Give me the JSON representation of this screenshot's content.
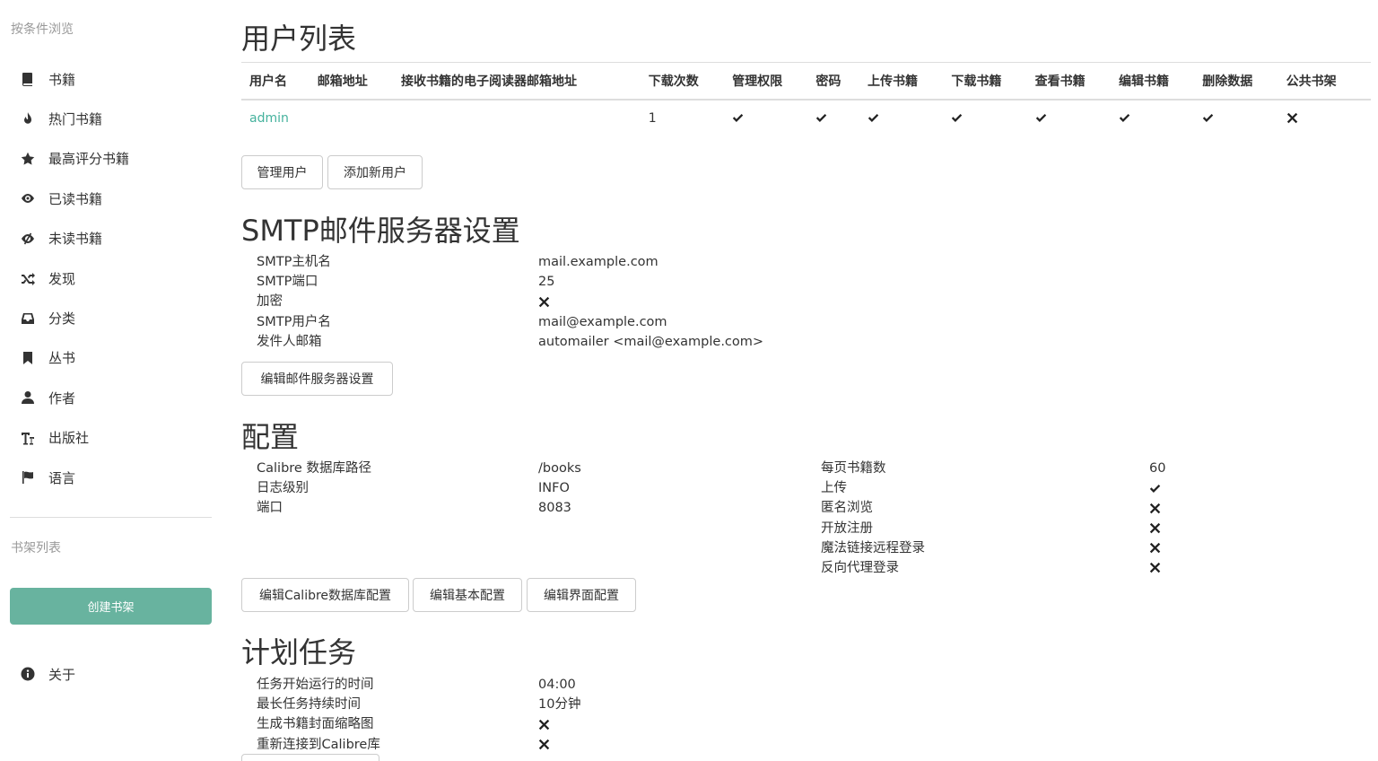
{
  "sidebar": {
    "browse_heading": "按条件浏览",
    "items": [
      {
        "label": "书籍",
        "icon": "book-icon"
      },
      {
        "label": "热门书籍",
        "icon": "fire-icon"
      },
      {
        "label": "最高评分书籍",
        "icon": "star-icon"
      },
      {
        "label": "已读书籍",
        "icon": "eye-icon"
      },
      {
        "label": "未读书籍",
        "icon": "eye-slash-icon"
      },
      {
        "label": "发现",
        "icon": "random-icon"
      },
      {
        "label": "分类",
        "icon": "inbox-icon"
      },
      {
        "label": "丛书",
        "icon": "bookmark-icon"
      },
      {
        "label": "作者",
        "icon": "user-icon"
      },
      {
        "label": "出版社",
        "icon": "text-size-icon"
      },
      {
        "label": "语言",
        "icon": "flag-icon"
      }
    ],
    "shelves_heading": "书架列表",
    "create_shelf": "创建书架",
    "about": "关于"
  },
  "users": {
    "title": "用户列表",
    "columns": [
      "用户名",
      "邮箱地址",
      "接收书籍的电子阅读器邮箱地址",
      "下载次数",
      "管理权限",
      "密码",
      "上传书籍",
      "下载书籍",
      "查看书籍",
      "编辑书籍",
      "删除数据",
      "公共书架"
    ],
    "rows": [
      {
        "username": "admin",
        "email": "",
        "kindle": "",
        "downloads": "1",
        "admin": true,
        "password": true,
        "upload": true,
        "download": true,
        "view": true,
        "edit": true,
        "delete": true,
        "public_shelf": false
      }
    ],
    "manage_button": "管理用户",
    "add_button": "添加新用户"
  },
  "smtp": {
    "title": "SMTP邮件服务器设置",
    "rows": [
      {
        "label": "SMTP主机名",
        "value": "mail.example.com"
      },
      {
        "label": "SMTP端口",
        "value": "25"
      },
      {
        "label": "加密",
        "bool": false
      },
      {
        "label": "SMTP用户名",
        "value": "mail@example.com"
      },
      {
        "label": "发件人邮箱",
        "value": "automailer <mail@example.com>"
      }
    ],
    "edit_button": "编辑邮件服务器设置"
  },
  "config": {
    "title": "配置",
    "left_rows": [
      {
        "label": "Calibre 数据库路径",
        "value": "/books"
      },
      {
        "label": "日志级别",
        "value": "INFO"
      },
      {
        "label": "端口",
        "value": "8083"
      }
    ],
    "right_rows": [
      {
        "label": "每页书籍数",
        "value": "60"
      },
      {
        "label": "上传",
        "bool": true
      },
      {
        "label": "匿名浏览",
        "bool": false
      },
      {
        "label": "开放注册",
        "bool": false
      },
      {
        "label": "魔法链接远程登录",
        "bool": false
      },
      {
        "label": "反向代理登录",
        "bool": false
      }
    ],
    "edit_db_button": "编辑Calibre数据库配置",
    "edit_basic_button": "编辑基本配置",
    "edit_ui_button": "编辑界面配置"
  },
  "tasks": {
    "title": "计划任务",
    "rows": [
      {
        "label": "任务开始运行的时间",
        "value": "04:00"
      },
      {
        "label": "最长任务持续时间",
        "value": "10分钟"
      },
      {
        "label": "生成书籍封面缩略图",
        "bool": false
      },
      {
        "label": "重新连接到Calibre库",
        "bool": false
      }
    ]
  }
}
